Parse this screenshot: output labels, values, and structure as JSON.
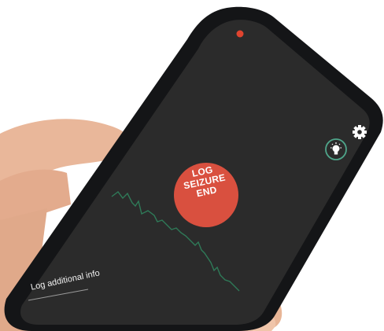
{
  "colors": {
    "screen": "#2b2b2b",
    "phone_frame": "#111214",
    "accent_red": "#d9503f",
    "status_dot": "#e0442f",
    "wave_green": "#2f7a58",
    "bulb_ring": "#4fa58a"
  },
  "screen": {
    "log_button_lines": [
      "LOG",
      "SEIZURE",
      "END"
    ],
    "log_additional_label": "Log additional info"
  },
  "icons": [
    "settings-gear-icon",
    "lightbulb-icon",
    "recording-dot-icon"
  ]
}
